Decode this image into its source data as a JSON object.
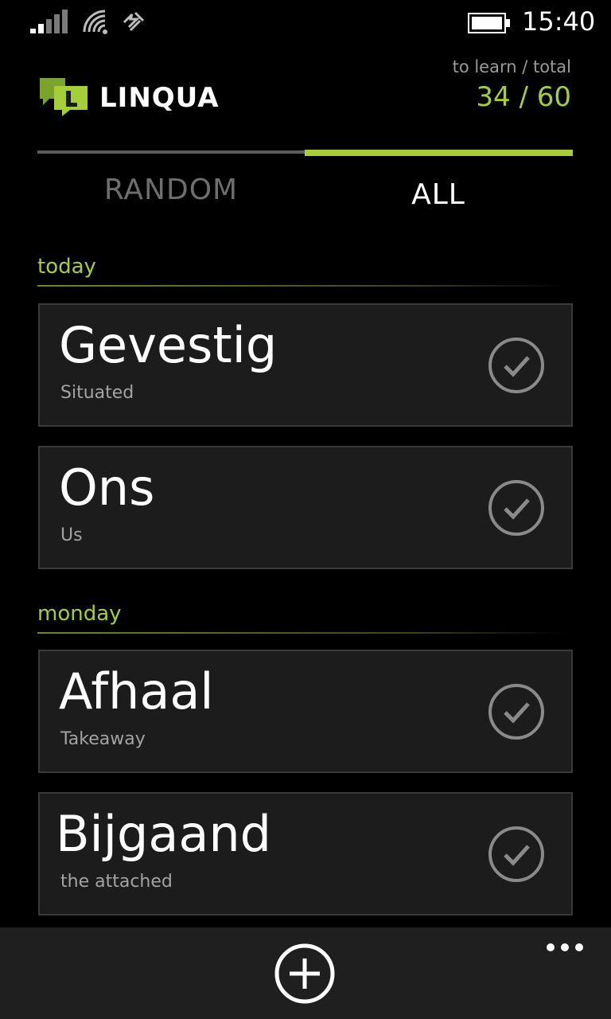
{
  "status_bar": {
    "time": "15:40",
    "icons": [
      "signal-icon",
      "wifi-icon",
      "data-icon",
      "battery-icon"
    ]
  },
  "header": {
    "app_name": "LINQUA",
    "logo_icon": "linqua-logo-icon",
    "counter_label": "to learn / total",
    "counter_value": "34 / 60"
  },
  "tabs": [
    {
      "label": "RANDOM",
      "active": false
    },
    {
      "label": "ALL",
      "active": true
    }
  ],
  "sections": [
    {
      "heading": "today",
      "items": [
        {
          "word": "Gevestig",
          "translation": "Situated",
          "icon": "check-circle-icon"
        },
        {
          "word": "Ons",
          "translation": "Us",
          "icon": "check-circle-icon"
        }
      ]
    },
    {
      "heading": "monday",
      "items": [
        {
          "word": "Afhaal",
          "translation": "Takeaway",
          "icon": "check-circle-icon"
        },
        {
          "word": "Bijgaand",
          "translation": "the attached",
          "icon": "check-circle-icon"
        }
      ]
    }
  ],
  "app_bar": {
    "buttons": [
      "add-icon"
    ],
    "more_icon": "more-ellipsis-icon"
  },
  "colors": {
    "accent": "#a6ce39",
    "card_bg": "#1c1c1c",
    "app_bar_bg": "#1f1f1f",
    "background": "#000000"
  }
}
